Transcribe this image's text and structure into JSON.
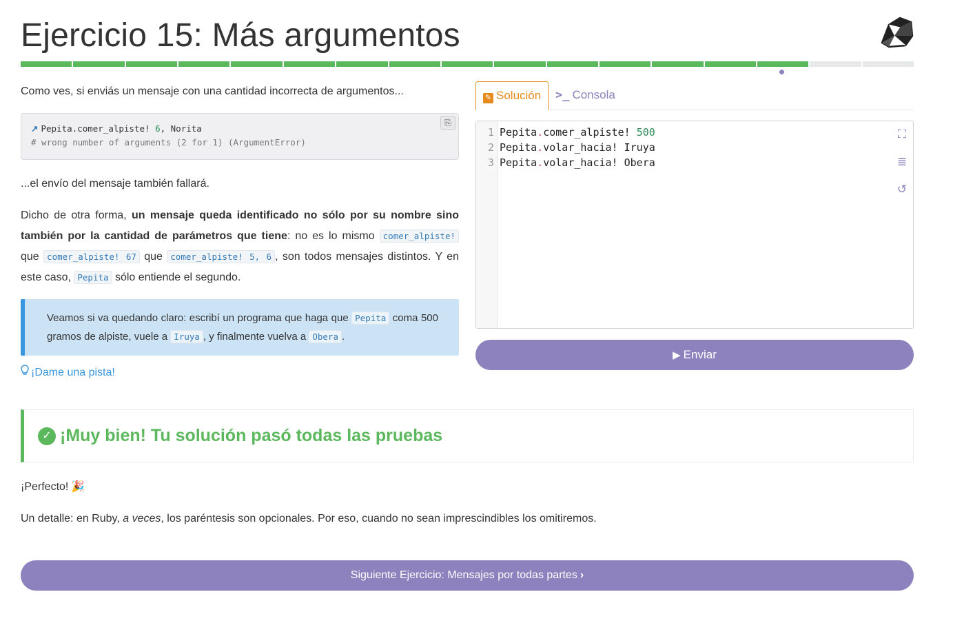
{
  "page": {
    "title": "Ejercicio 15: Más argumentos"
  },
  "progress": {
    "completed": 15,
    "total": 17,
    "current": 15
  },
  "description": {
    "intro": "Como ves, si enviás un mensaje con una cantidad incorrecta de argumentos...",
    "code_example": {
      "receiver": "Pepita",
      "message": ".comer_alpiste! ",
      "arg1": "6",
      "sep": ", ",
      "arg2": "Norita",
      "comment": "# wrong number of arguments (2 for 1) (ArgumentError)"
    },
    "fail_text": "...el envío del mensaje también fallará.",
    "para2": {
      "t1": "Dicho de otra forma, ",
      "bold": "un mensaje queda identificado no sólo por su nombre sino también por la cantidad de parámetros que tiene",
      "t2": ": no es lo mismo ",
      "code1": "comer_alpiste!",
      "t3": " que ",
      "code2": "comer_alpiste! 67",
      "t4": " que ",
      "code3": "comer_alpiste! 5, 6",
      "t5": ", son todos mensajes distintos. Y en este caso, ",
      "code4": "Pepita",
      "t6": " sólo entiende el segundo."
    },
    "instruction": {
      "t1": "Veamos si va quedando claro: escribí un programa que haga que ",
      "code1": "Pepita",
      "t2": " coma 500 gramos de alpiste, vuele a ",
      "code2": "Iruya",
      "t3": ", y finalmente vuelva a ",
      "code3": "Obera",
      "t4": "."
    },
    "hint_label": "¡Dame una pista!"
  },
  "tabs": {
    "solution": "Solución",
    "console": "Consola"
  },
  "editor": {
    "lines": [
      {
        "num": "1",
        "recv": "Pepita",
        "dot": ".",
        "msg": "comer_alpiste! ",
        "arg": "500"
      },
      {
        "num": "2",
        "recv": "Pepita",
        "dot": ".",
        "msg": "volar_hacia! ",
        "arg": "Iruya"
      },
      {
        "num": "3",
        "recv": "Pepita",
        "dot": ".",
        "msg": "volar_hacia! ",
        "arg": "Obera"
      }
    ]
  },
  "send_button": "Enviar",
  "result": {
    "message": "¡Muy bien! Tu solución pasó todas las pruebas"
  },
  "feedback": {
    "perfect": "¡Perfecto!",
    "detail_t1": "Un detalle: en Ruby, ",
    "detail_em": "a veces",
    "detail_t2": ", los paréntesis son opcionales. Por eso, cuando no sean imprescindibles los omitiremos."
  },
  "next_button": "Siguiente Ejercicio: Mensajes por todas partes",
  "colors": {
    "accent": "#8e82be",
    "success": "#5cb85c",
    "info": "#3a96dd",
    "tab_active": "#e68a1d"
  }
}
